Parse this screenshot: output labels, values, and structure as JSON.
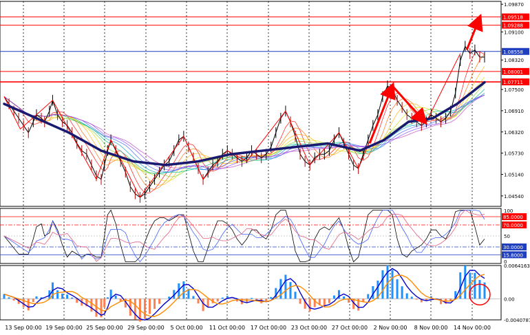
{
  "chart_data": [
    {
      "type": "line",
      "pane": "price",
      "title": "",
      "series_name": "",
      "ylim": [
        1.0425,
        1.0995
      ],
      "y_ticks": [
        "1.09870",
        "1.09100",
        "1.08320",
        "1.07500",
        "1.06910",
        "1.06320",
        "1.05730",
        "1.05140",
        "1.04540"
      ],
      "y_tick_values": [
        1.0987,
        1.091,
        1.0832,
        1.075,
        1.0691,
        1.0632,
        1.0573,
        1.0514,
        1.0454
      ],
      "horizontal_levels": [
        {
          "label": "1.09518",
          "value": 1.09518,
          "color": "#ff0000"
        },
        {
          "label": "1.09288",
          "value": 1.09288,
          "color": "#ff0000"
        },
        {
          "label": "1.08558",
          "value": 1.08558,
          "color": "#1f3fbf"
        },
        {
          "label": "1.08001",
          "value": 1.08001,
          "color": "#ff0000"
        },
        {
          "label": "1.07711",
          "value": 1.07711,
          "color": "#ff0000"
        }
      ],
      "price_path": [
        [
          0,
          1.073
        ],
        [
          3,
          1.071
        ],
        [
          6,
          1.069
        ],
        [
          9,
          1.067
        ],
        [
          12,
          1.065
        ],
        [
          15,
          1.063
        ],
        [
          18,
          1.066
        ],
        [
          20,
          1.068
        ],
        [
          23,
          1.067
        ],
        [
          25,
          1.066
        ],
        [
          28,
          1.069
        ],
        [
          30,
          1.072
        ],
        [
          33,
          1.068
        ],
        [
          36,
          1.066
        ],
        [
          39,
          1.065
        ],
        [
          42,
          1.063
        ],
        [
          45,
          1.06
        ],
        [
          48,
          1.058
        ],
        [
          51,
          1.057
        ],
        [
          54,
          1.054
        ],
        [
          57,
          1.051
        ],
        [
          60,
          1.05
        ],
        [
          62,
          1.054
        ],
        [
          64,
          1.058
        ],
        [
          66,
          1.061
        ],
        [
          69,
          1.058
        ],
        [
          72,
          1.055
        ],
        [
          75,
          1.052
        ],
        [
          78,
          1.048
        ],
        [
          81,
          1.046
        ],
        [
          84,
          1.045
        ],
        [
          87,
          1.046
        ],
        [
          90,
          1.048
        ],
        [
          93,
          1.05
        ],
        [
          96,
          1.052
        ],
        [
          99,
          1.054
        ],
        [
          102,
          1.055
        ],
        [
          105,
          1.058
        ],
        [
          108,
          1.061
        ],
        [
          111,
          1.062
        ],
        [
          114,
          1.059
        ],
        [
          117,
          1.056
        ],
        [
          120,
          1.053
        ],
        [
          123,
          1.05
        ],
        [
          126,
          1.052
        ],
        [
          129,
          1.054
        ],
        [
          132,
          1.055
        ],
        [
          135,
          1.057
        ],
        [
          138,
          1.058
        ],
        [
          141,
          1.057
        ],
        [
          144,
          1.056
        ],
        [
          147,
          1.055
        ],
        [
          150,
          1.056
        ],
        [
          153,
          1.058
        ],
        [
          156,
          1.057
        ],
        [
          159,
          1.056
        ],
        [
          162,
          1.057
        ],
        [
          165,
          1.059
        ],
        [
          168,
          1.063
        ],
        [
          171,
          1.067
        ],
        [
          174,
          1.069
        ],
        [
          177,
          1.066
        ],
        [
          180,
          1.062
        ],
        [
          183,
          1.057
        ],
        [
          186,
          1.055
        ],
        [
          189,
          1.054
        ],
        [
          192,
          1.056
        ],
        [
          195,
          1.057
        ],
        [
          198,
          1.057
        ],
        [
          201,
          1.058
        ],
        [
          204,
          1.061
        ],
        [
          207,
          1.063
        ],
        [
          210,
          1.06
        ],
        [
          213,
          1.057
        ],
        [
          216,
          1.054
        ],
        [
          219,
          1.053
        ],
        [
          222,
          1.057
        ],
        [
          225,
          1.061
        ],
        [
          228,
          1.065
        ],
        [
          231,
          1.068
        ],
        [
          234,
          1.073
        ],
        [
          237,
          1.076
        ],
        [
          240,
          1.075
        ],
        [
          243,
          1.072
        ],
        [
          246,
          1.07
        ],
        [
          249,
          1.068
        ],
        [
          252,
          1.067
        ],
        [
          255,
          1.066
        ],
        [
          258,
          1.065
        ],
        [
          261,
          1.066
        ],
        [
          264,
          1.068
        ],
        [
          267,
          1.067
        ],
        [
          270,
          1.066
        ],
        [
          273,
          1.067
        ],
        [
          276,
          1.069
        ],
        [
          279,
          1.074
        ],
        [
          282,
          1.083
        ],
        [
          285,
          1.087
        ],
        [
          288,
          1.085
        ],
        [
          291,
          1.086
        ],
        [
          294,
          1.084
        ],
        [
          297,
          1.084
        ]
      ],
      "lower_zigzag": [
        [
          0,
          1.073
        ],
        [
          10,
          1.064
        ],
        [
          20,
          1.068
        ],
        [
          30,
          1.072
        ],
        [
          57,
          1.05
        ],
        [
          66,
          1.061
        ],
        [
          84,
          1.045
        ],
        [
          111,
          1.062
        ],
        [
          123,
          1.05
        ],
        [
          138,
          1.058
        ],
        [
          150,
          1.055
        ],
        [
          174,
          1.069
        ],
        [
          189,
          1.054
        ],
        [
          207,
          1.063
        ],
        [
          219,
          1.053
        ],
        [
          240,
          1.076
        ],
        [
          261,
          1.066
        ],
        [
          282,
          1.085
        ]
      ],
      "trend_line": [
        [
          0,
          1.071
        ],
        [
          20,
          1.067
        ],
        [
          40,
          1.063
        ],
        [
          60,
          1.058
        ],
        [
          80,
          1.055
        ],
        [
          100,
          1.054
        ],
        [
          120,
          1.055
        ],
        [
          140,
          1.057
        ],
        [
          160,
          1.058
        ],
        [
          180,
          1.059
        ],
        [
          200,
          1.06
        ],
        [
          220,
          1.058
        ],
        [
          235,
          1.061
        ],
        [
          250,
          1.066
        ],
        [
          265,
          1.067
        ],
        [
          280,
          1.071
        ],
        [
          297,
          1.077
        ]
      ],
      "annotation_arrows": [
        {
          "from": [
            226,
            1.06
          ],
          "to": [
            240,
            1.076
          ],
          "color": "#ff0000"
        },
        {
          "from": [
            240,
            1.076
          ],
          "to": [
            260,
            1.066
          ],
          "color": "#ff0000"
        },
        {
          "from": [
            286,
            1.086
          ],
          "to": [
            294,
            1.095
          ],
          "color": "#ff0000"
        }
      ]
    },
    {
      "type": "line",
      "pane": "oscillator",
      "ylim": [
        0,
        100
      ],
      "y_ticks": [
        "100",
        "85.0000",
        "70.0000",
        "50",
        "30.0000",
        "15.8000",
        "0"
      ],
      "levels": [
        {
          "label": "85.0000",
          "value": 85,
          "color": "#ff0000"
        },
        {
          "label": "70.0000",
          "value": 70,
          "color": "#ff0000"
        },
        {
          "label": "30.0000",
          "value": 30,
          "color": "#1f3fbf"
        },
        {
          "label": "15.8000",
          "value": 15.8,
          "color": "#1f3fbf"
        }
      ]
    },
    {
      "type": "bar",
      "pane": "macd",
      "ylim": [
        -0.0040787,
        0.0064163
      ],
      "y_ticks": [
        "0.0064163",
        "0.00",
        "-0.0040787"
      ],
      "x_ticks": [
        "13 Sep 00:00",
        "19 Sep 00:00",
        "25 Sep 00:00",
        "29 Sep 00:00",
        "5 Oct 00:00",
        "11 Oct 00:00",
        "17 Oct 00:00",
        "23 Oct 00:00",
        "27 Oct 00:00",
        "2 Nov 00:00",
        "8 Nov 00:00",
        "14 Nov 00:00"
      ],
      "histogram_colors": {
        "positive": "#1e90ff",
        "negative": "#ff7f50"
      },
      "highlight": "circle at last bars",
      "line_colors": {
        "main": "#0000cd",
        "signal": "#ff8c00"
      }
    }
  ],
  "colors": {
    "background": "#ffffff",
    "grid": "#000000",
    "price": "#000000",
    "trend": "#191970"
  }
}
